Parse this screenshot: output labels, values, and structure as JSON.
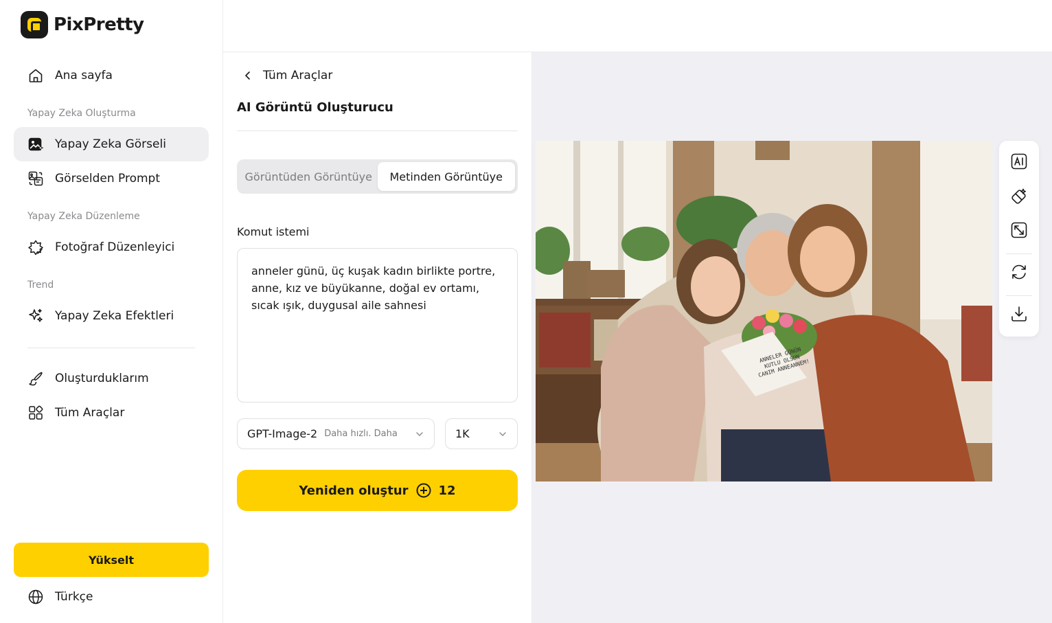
{
  "app": {
    "name": "PixPretty"
  },
  "sidebar": {
    "home": "Ana sayfa",
    "sections": {
      "create": "Yapay Zeka Oluşturma",
      "edit": "Yapay Zeka Düzenleme",
      "trend": "Trend"
    },
    "items": {
      "ai_image": "Yapay Zeka Görseli",
      "image_to_prompt": "Görselden Prompt",
      "photo_editor": "Fotoğraf Düzenleyici",
      "ai_effects": "Yapay Zeka Efektleri",
      "my_creations": "Oluşturduklarım",
      "all_tools": "Tüm Araçlar"
    },
    "active_item": "ai_image",
    "upgrade": "Yükselt",
    "language": "Türkçe"
  },
  "panel": {
    "back": "Tüm Araçlar",
    "title": "AI Görüntü Oluşturucu",
    "tabs": [
      "Görüntüden Görüntüye",
      "Metinden Görüntüye"
    ],
    "active_tab": 1,
    "prompt_label": "Komut istemi",
    "prompt_value": "anneler günü, üç kuşak kadın birlikte portre, anne, kız ve büyükanne, doğal ev ortamı, sıcak ışık, duygusal aile sahnesi",
    "model": {
      "name": "GPT-Image-2",
      "desc": "Daha hızlı. Daha"
    },
    "resolution": "1K",
    "generate": {
      "label": "Yeniden oluştur",
      "cost": "12"
    }
  },
  "canvas": {
    "card_text": "ANNELER GÜNÜN KUTLU OLSUN CANIM ANNEANNEM!",
    "tools": [
      "ai-text-icon",
      "eraser-icon",
      "expand-icon",
      "refresh-icon",
      "download-icon"
    ]
  },
  "colors": {
    "accent": "#ffd000",
    "canvas_bg": "#f0f0f4",
    "active_nav": "#efeff1"
  }
}
